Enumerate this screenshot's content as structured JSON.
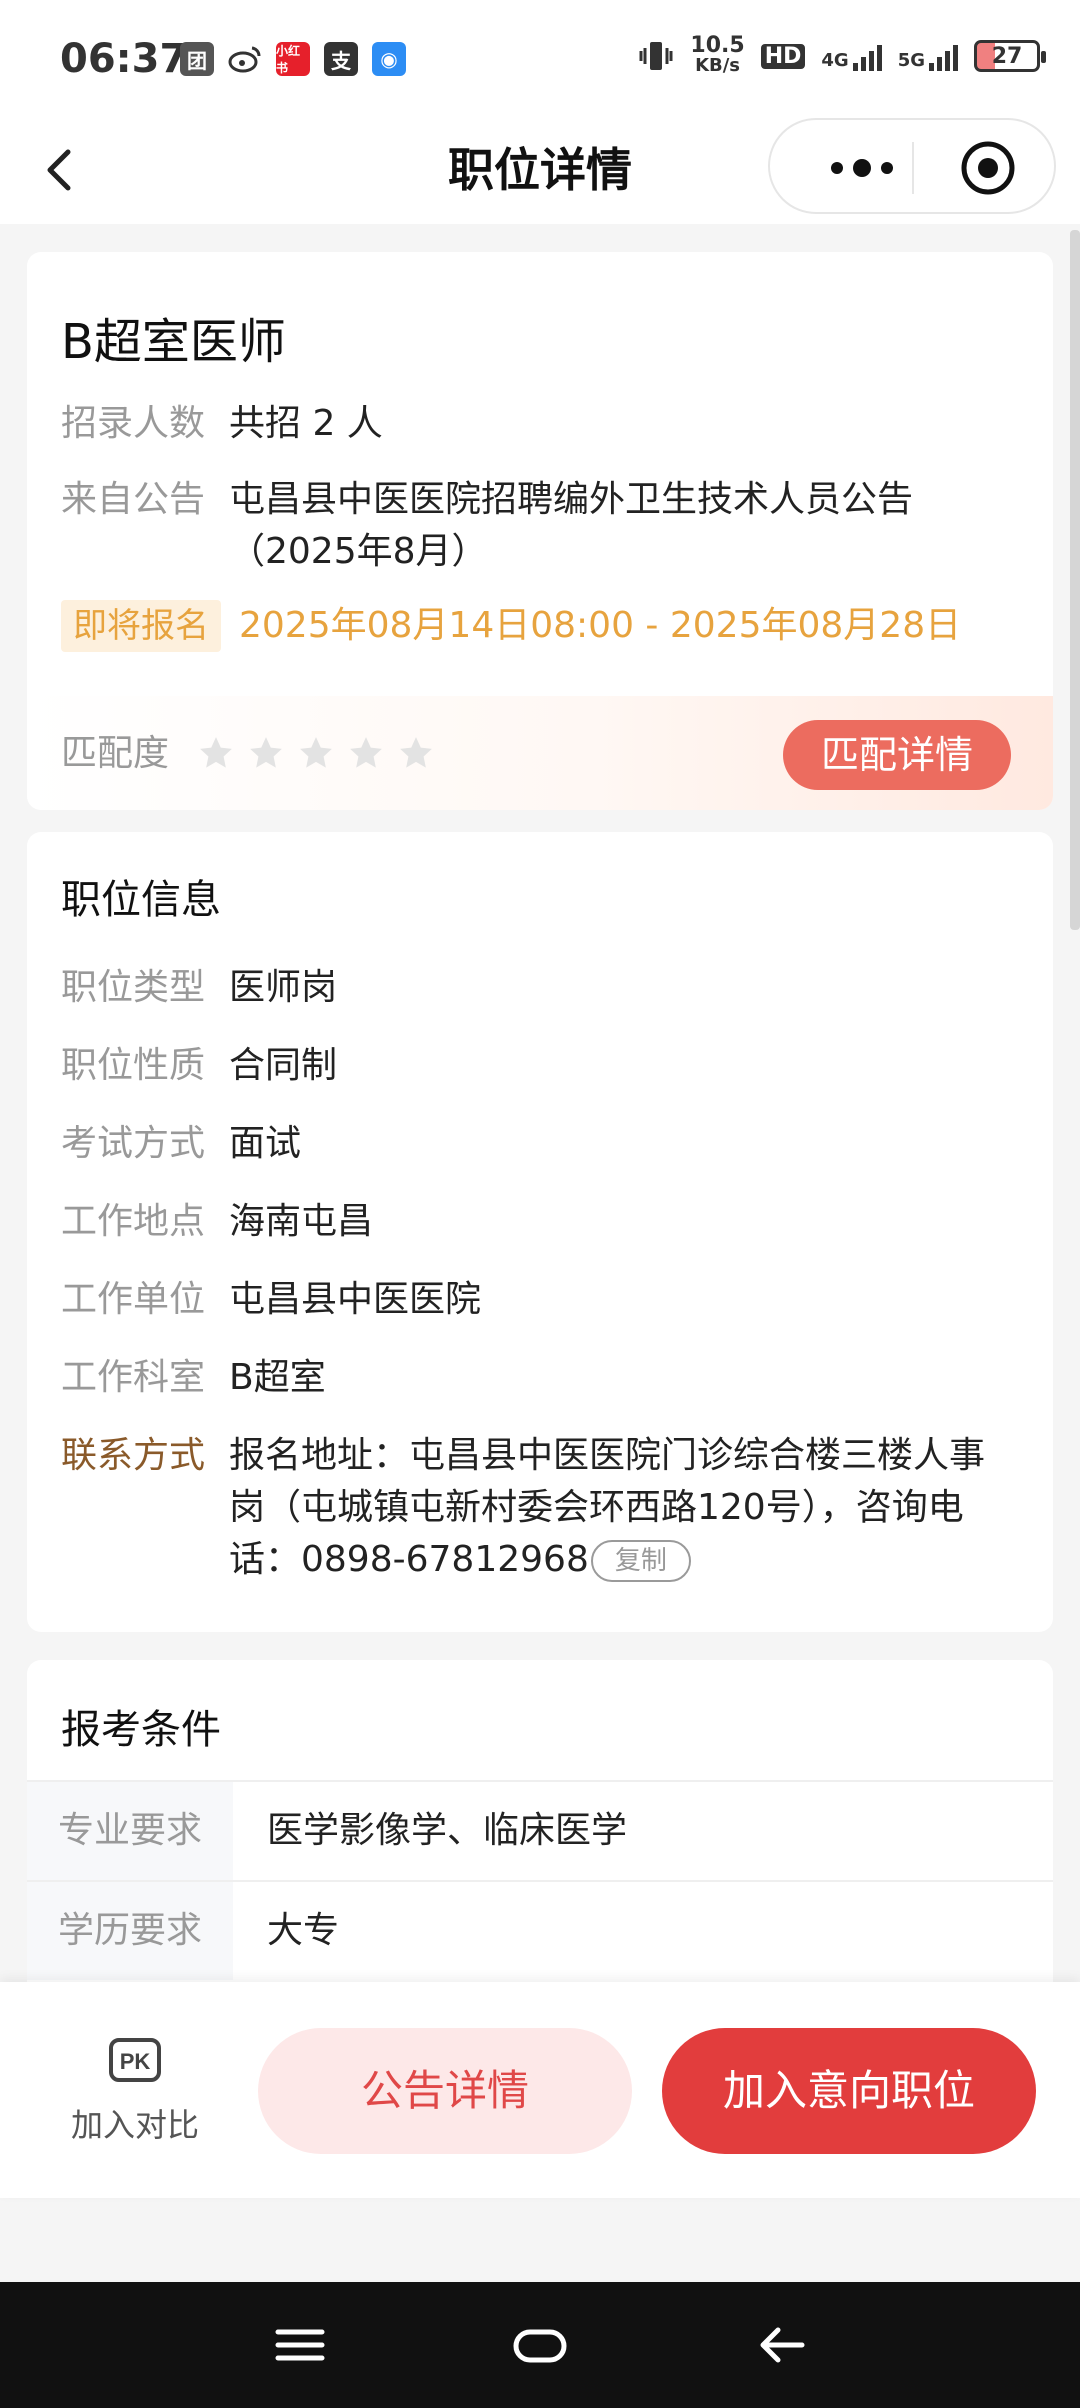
{
  "status_bar": {
    "time": "06:37",
    "net_speed_value": "10.5",
    "net_speed_unit": "KB/s",
    "hd_label": "HD",
    "sim1_label": "4G",
    "sim2_label": "5G",
    "battery": "27",
    "app_icons": [
      "app-icon-tuanyou",
      "weibo-icon",
      "xiaohongshu-icon",
      "alipay-icon",
      "location-app-icon"
    ]
  },
  "nav": {
    "title": "职位详情"
  },
  "job": {
    "title": "B超室医师",
    "recruit_label": "招录人数",
    "recruit_value": "共招 2 人",
    "source_label": "来自公告",
    "source_value": "屯昌县中医医院招聘编外卫生技术人员公告（2025年8月）",
    "status_badge": "即将报名",
    "signup_period": "2025年08月14日08:00 - 2025年08月28日",
    "match_label": "匹配度",
    "match_stars": 0,
    "match_stars_total": 5,
    "match_button": "匹配详情"
  },
  "position_info": {
    "section_title": "职位信息",
    "rows": [
      {
        "label": "职位类型",
        "value": "医师岗"
      },
      {
        "label": "职位性质",
        "value": "合同制"
      },
      {
        "label": "考试方式",
        "value": "面试"
      },
      {
        "label": "工作地点",
        "value": "海南屯昌"
      },
      {
        "label": "工作单位",
        "value": "屯昌县中医医院"
      },
      {
        "label": "工作科室",
        "value": "B超室"
      }
    ],
    "contact_label": "联系方式",
    "contact_value": "报名地址：屯昌县中医医院门诊综合楼三楼人事岗（屯城镇屯新村委会环西路120号），咨询电话：0898-67812968",
    "copy_button": "复制"
  },
  "requirements": {
    "section_title": "报考条件",
    "rows": [
      {
        "label": "专业要求",
        "value": "医学影像学、临床医学"
      },
      {
        "label": "学历要求",
        "value": "大专"
      }
    ]
  },
  "actions": {
    "compare_icon_text": "PK",
    "compare_label": "加入对比",
    "notice_button": "公告详情",
    "intent_button": "加入意向职位"
  },
  "colors": {
    "accent_orange": "#e7a33e",
    "primary_red": "#e23d3d",
    "match_button": "#ec6c5f"
  }
}
